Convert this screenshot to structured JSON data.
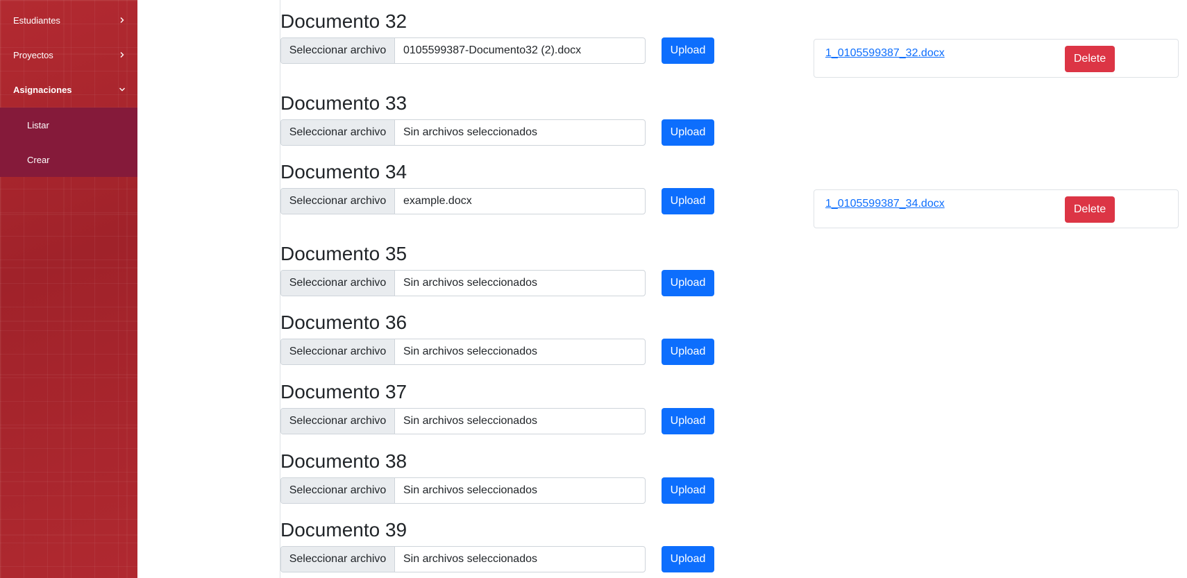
{
  "sidebar": {
    "items": [
      {
        "label": "Estudiantes",
        "icon": "chevron-right-icon"
      },
      {
        "label": "Proyectos",
        "icon": "chevron-right-icon"
      },
      {
        "label": "Asignaciones",
        "icon": "chevron-down-icon"
      }
    ],
    "submenu": [
      {
        "label": "Listar"
      },
      {
        "label": "Crear"
      }
    ]
  },
  "documents": [
    {
      "title": "Documento 32",
      "choose_label": "Seleccionar archivo",
      "file_name": "0105599387-Documento32 (2).docx",
      "upload_label": "Upload"
    },
    {
      "title": "Documento 33",
      "choose_label": "Seleccionar archivo",
      "file_name": "Sin archivos seleccionados",
      "upload_label": "Upload"
    },
    {
      "title": "Documento 34",
      "choose_label": "Seleccionar archivo",
      "file_name": "example.docx",
      "upload_label": "Upload"
    },
    {
      "title": "Documento 35",
      "choose_label": "Seleccionar archivo",
      "file_name": "Sin archivos seleccionados",
      "upload_label": "Upload"
    },
    {
      "title": "Documento 36",
      "choose_label": "Seleccionar archivo",
      "file_name": "Sin archivos seleccionados",
      "upload_label": "Upload"
    },
    {
      "title": "Documento 37",
      "choose_label": "Seleccionar archivo",
      "file_name": "Sin archivos seleccionados",
      "upload_label": "Upload"
    },
    {
      "title": "Documento 38",
      "choose_label": "Seleccionar archivo",
      "file_name": "Sin archivos seleccionados",
      "upload_label": "Upload"
    },
    {
      "title": "Documento 39",
      "choose_label": "Seleccionar archivo",
      "file_name": "Sin archivos seleccionados",
      "upload_label": "Upload"
    }
  ],
  "uploaded_files": [
    {
      "link": "1_0105599387_32.docx",
      "delete_label": "Delete"
    },
    {
      "link": "1_0105599387_34.docx",
      "delete_label": "Delete"
    }
  ],
  "colors": {
    "sidebar": "#a8232b",
    "submenu": "#851a3a",
    "primary": "#0d6efd",
    "danger": "#dc3545"
  }
}
